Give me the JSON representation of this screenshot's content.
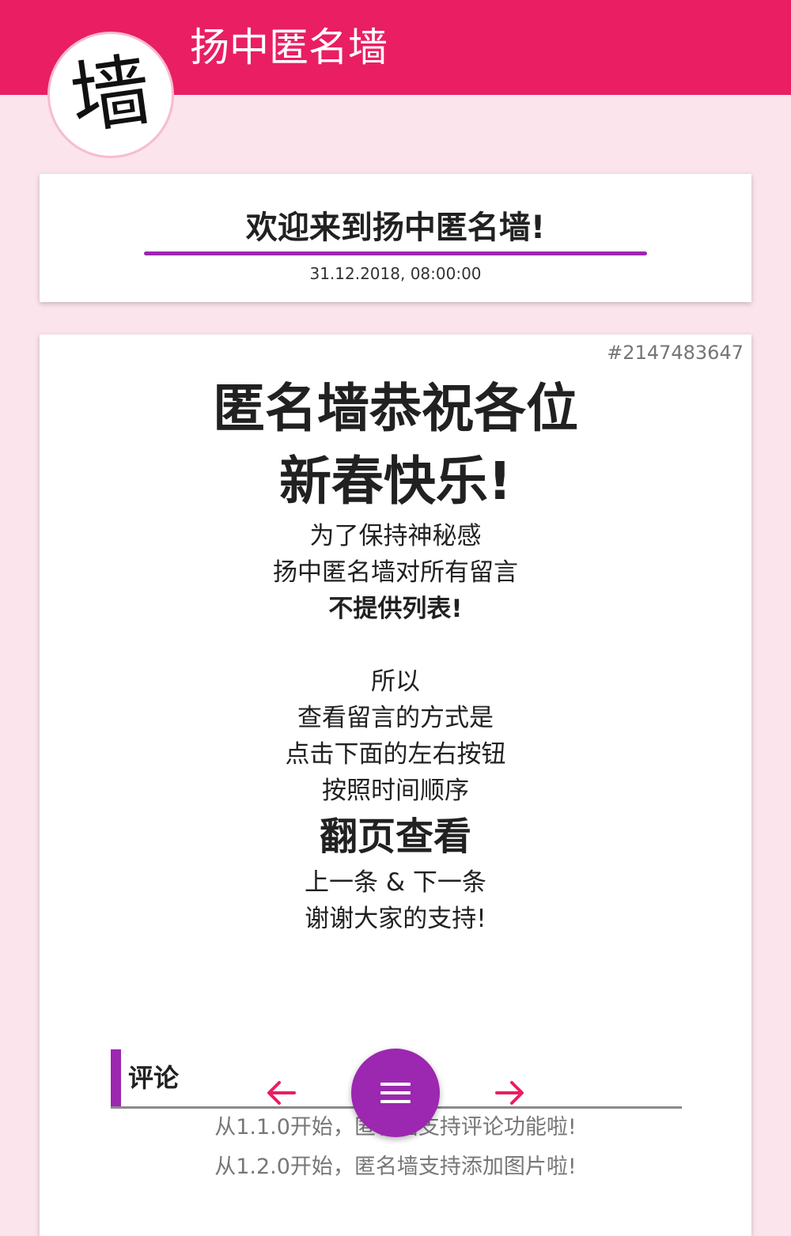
{
  "header": {
    "title": "扬中匿名墙",
    "logo_char": "墙"
  },
  "welcome": {
    "title": "欢迎来到扬中匿名墙!",
    "date": "31.12.2018, 08:00:00"
  },
  "post": {
    "id": "#2147483647",
    "headline_1": "匿名墙恭祝各位",
    "headline_2": "新春快乐!",
    "line_1": "为了保持神秘感",
    "line_2": "扬中匿名墙对所有留言",
    "line_3": "不提供列表!",
    "line_4": "所以",
    "line_5": "查看留言的方式是",
    "line_6": "点击下面的左右按钮",
    "line_7": "按照时间顺序",
    "line_8": "翻页查看",
    "line_9": "上一条 & 下一条",
    "line_10": "谢谢大家的支持!"
  },
  "comments": {
    "label": "评论",
    "items": [
      "从1.1.0开始，匿名墙支持评论功能啦!",
      "从1.2.0开始，匿名墙支持添加图片啦!"
    ]
  },
  "navigation": {
    "prev_icon": "arrow-left-icon",
    "next_icon": "arrow-right-icon",
    "menu_icon": "menu-icon"
  },
  "colors": {
    "header": "#e91e63",
    "background": "#fbe4ec",
    "accent": "#9c27b0",
    "arrow": "#e91e63"
  }
}
